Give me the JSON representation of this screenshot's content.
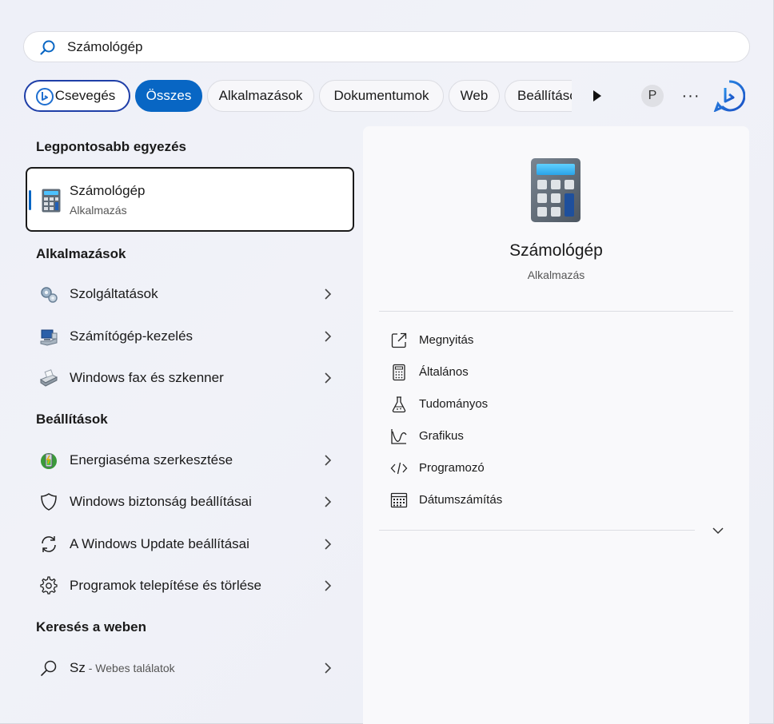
{
  "search": {
    "value": "Számológép",
    "placeholder": ""
  },
  "chips": [
    {
      "label": "Csevegés"
    },
    {
      "label": "Összes"
    },
    {
      "label": "Alkalmazások"
    },
    {
      "label": "Dokumentumok"
    },
    {
      "label": "Web"
    },
    {
      "label": "Beállítások"
    }
  ],
  "profile": {
    "initial": "P"
  },
  "more": {
    "label": "···"
  },
  "best_match": {
    "title": "Legpontosabb egyezés",
    "name": "Számológép",
    "type": "Alkalmazás"
  },
  "apps": {
    "title": "Alkalmazások",
    "items": [
      {
        "label": "Szolgáltatások",
        "icon": "services-gears-icon"
      },
      {
        "label": "Számítógép-kezelés",
        "icon": "computer-management-icon"
      },
      {
        "label": "Windows fax és szkenner",
        "icon": "fax-scanner-icon"
      }
    ]
  },
  "settings": {
    "title": "Beállítások",
    "items": [
      {
        "label": "Energiaséma szerkesztése",
        "icon": "power-plan-icon"
      },
      {
        "label": "Windows biztonság beállításai",
        "icon": "shield-icon"
      },
      {
        "label": "A Windows Update beállításai",
        "icon": "sync-icon"
      },
      {
        "label": "Programok telepítése és törlése",
        "icon": "gear-icon"
      }
    ]
  },
  "web": {
    "title": "Keresés a weben",
    "query": "Sz",
    "suffix": " - Webes találatok"
  },
  "detail": {
    "title": "Számológép",
    "type": "Alkalmazás",
    "actions": [
      {
        "label": "Megnyitás",
        "icon": "open-external-icon"
      },
      {
        "label": "Általános",
        "icon": "calculator-icon"
      },
      {
        "label": "Tudományos",
        "icon": "flask-icon"
      },
      {
        "label": "Grafikus",
        "icon": "graph-icon"
      },
      {
        "label": "Programozó",
        "icon": "code-icon"
      },
      {
        "label": "Dátumszámítás",
        "icon": "calendar-icon"
      }
    ]
  },
  "colors": {
    "accent": "#0866c4",
    "chat_border": "#1f3fa8"
  }
}
